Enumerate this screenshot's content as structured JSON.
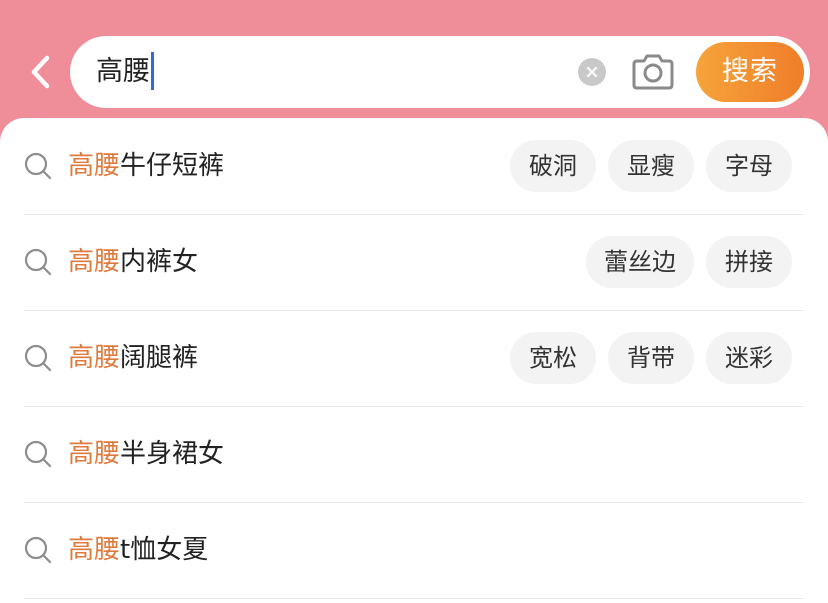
{
  "header": {
    "query": "高腰",
    "search_button_label": "搜索"
  },
  "suggestions": [
    {
      "highlight": "高腰",
      "rest": "牛仔短裤",
      "tags": [
        "破洞",
        "显瘦",
        "字母"
      ]
    },
    {
      "highlight": "高腰",
      "rest": "内裤女",
      "tags": [
        "蕾丝边",
        "拼接"
      ]
    },
    {
      "highlight": "高腰",
      "rest": "阔腿裤",
      "tags": [
        "宽松",
        "背带",
        "迷彩"
      ]
    },
    {
      "highlight": "高腰",
      "rest": "半身裙女",
      "tags": []
    },
    {
      "highlight": "高腰",
      "rest": "t恤女夏",
      "tags": []
    }
  ],
  "colors": {
    "header_bg": "#ef8e98",
    "highlight": "#e07a3c",
    "search_button": "#f07d2a"
  }
}
